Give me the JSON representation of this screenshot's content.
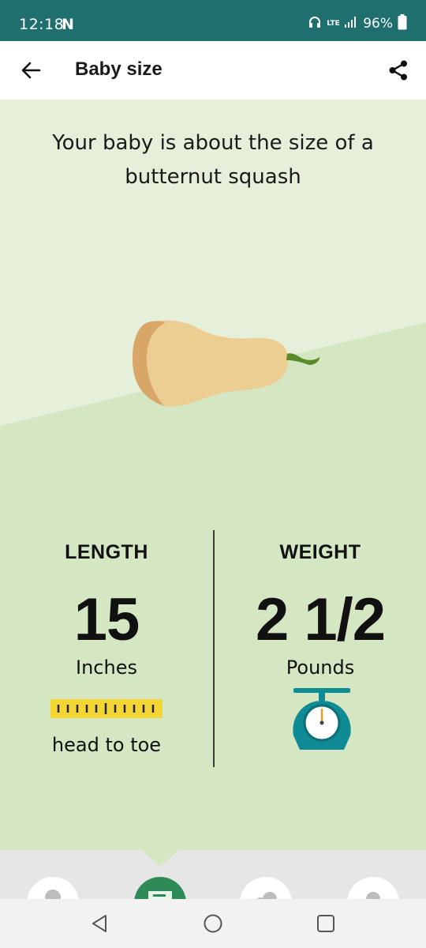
{
  "status": {
    "time": "12:18",
    "notification_glyph": "N",
    "network": "LTE",
    "battery": "96%"
  },
  "header": {
    "title": "Baby size"
  },
  "hero": {
    "line1": "Your baby is about the size of a",
    "line2": "butternut squash",
    "image": "butternut-squash"
  },
  "length": {
    "label": "LENGTH",
    "value": "15",
    "unit": "Inches",
    "description": "head to toe",
    "icon": "ruler-icon"
  },
  "weight": {
    "label": "WEIGHT",
    "value": "2 1/2",
    "unit": "Pounds",
    "icon": "scale-icon"
  },
  "tabs": [
    {
      "name": "tab-1"
    },
    {
      "name": "tab-2",
      "active": true
    },
    {
      "name": "tab-3"
    },
    {
      "name": "tab-4"
    }
  ],
  "colors": {
    "status_bar": "#1f6f6e",
    "hero_light": "#e5efd9",
    "hero_dark": "#d5e6c2",
    "ruler_yellow": "#f3d534",
    "scale_teal": "#0f8b95",
    "active_tab": "#2e8b57"
  }
}
